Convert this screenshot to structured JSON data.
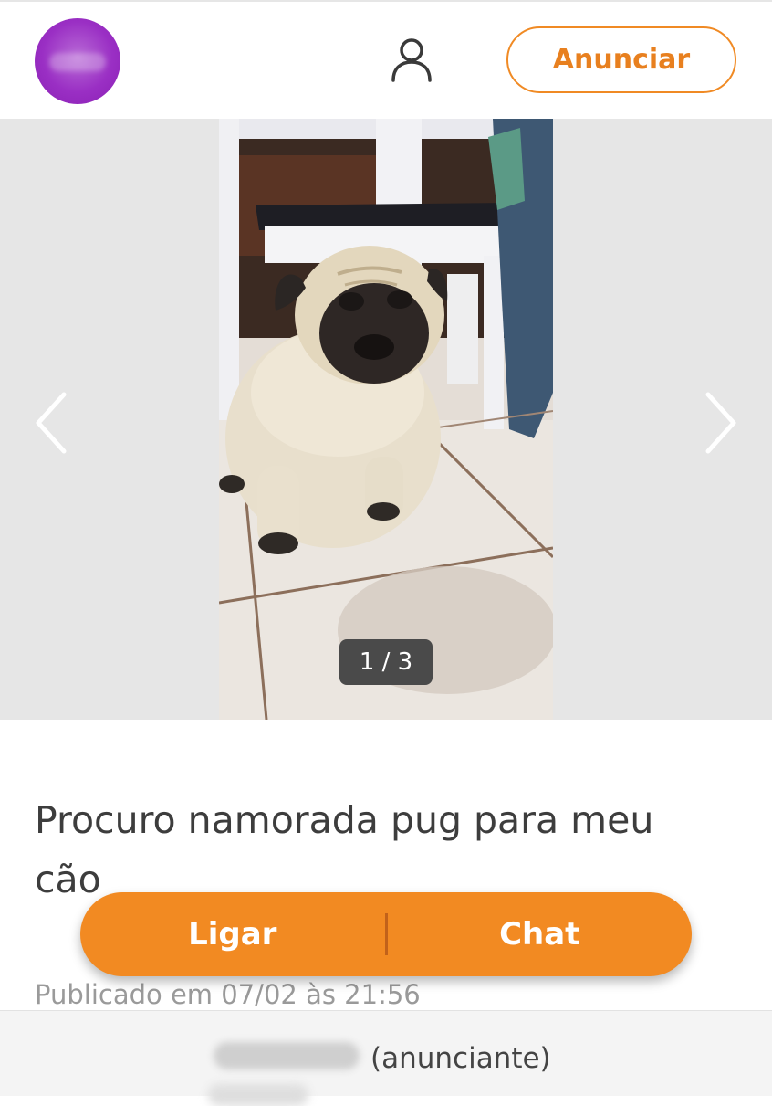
{
  "header": {
    "logo_icon": "purple-circle-logo",
    "profile_icon": "user-icon",
    "cta_label": "Anunciar",
    "accent_color": "#f08a24"
  },
  "gallery": {
    "counter": "1 / 3",
    "prev_icon": "chevron-left-icon",
    "next_icon": "chevron-right-icon",
    "photo_subject": "pug-photo"
  },
  "listing": {
    "title": "Procuro namorada pug para meu cão",
    "published": "Publicado em 07/02 às 21:56"
  },
  "actions": {
    "call_label": "Ligar",
    "chat_label": "Chat",
    "color": "#f28a22"
  },
  "footer": {
    "role_label": "(anunciante)"
  }
}
